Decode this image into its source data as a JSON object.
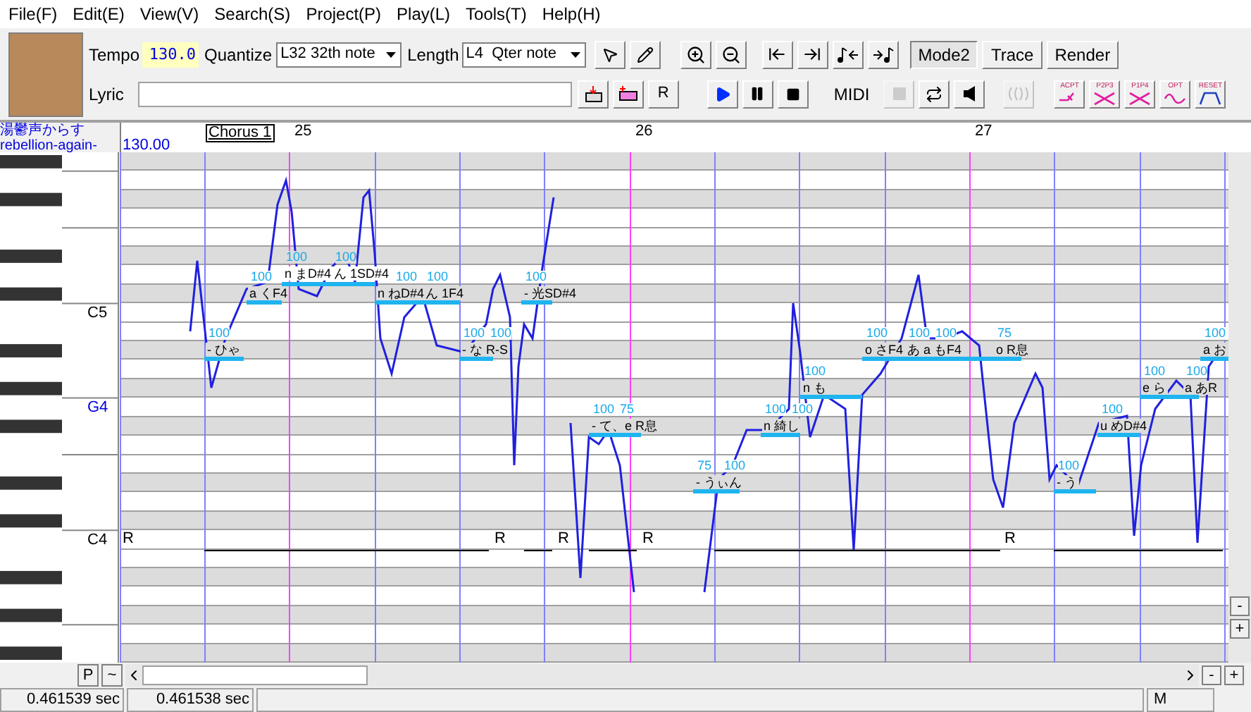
{
  "menu": [
    "File(F)",
    "Edit(E)",
    "View(V)",
    "Search(S)",
    "Project(P)",
    "Play(L)",
    "Tools(T)",
    "Help(H)"
  ],
  "toolbar": {
    "tempo_label": "Tempo",
    "tempo": "130.0",
    "quantize_label": "Quantize",
    "quantize": "L32 32th note",
    "length_label": "Length",
    "length": "L4  Qter note",
    "lyric_label": "Lyric",
    "insert_rest": "R",
    "midi_label": "MIDI"
  },
  "modes": [
    {
      "label": "Mode2",
      "selected": true
    },
    {
      "label": "Trace",
      "selected": false
    },
    {
      "label": "Render",
      "selected": false
    }
  ],
  "midi_buttons": [
    {
      "kind": "record",
      "disabled": true
    },
    {
      "kind": "sync",
      "disabled": false
    },
    {
      "kind": "speaker",
      "disabled": false
    },
    {
      "kind": "split",
      "disabled": true
    }
  ],
  "envelope_tools": [
    "ACPT",
    "P2P3",
    "P1P4",
    "OPT",
    "RESET"
  ],
  "track": {
    "singer": "湯鬱声からす",
    "name": "rebellion-again-"
  },
  "ruler": {
    "tempo": "130.00",
    "region": "Chorus 1",
    "bars": [
      "25",
      "26",
      "27"
    ]
  },
  "keys": [
    {
      "label": "C5",
      "selected": false
    },
    {
      "label": "G4",
      "selected": true
    },
    {
      "label": "C4",
      "selected": false
    }
  ],
  "notes": [
    {
      "kind": "rest",
      "lyric": "R"
    },
    {
      "kind": "note",
      "lyric": "- ひゃ",
      "velocities": [
        "100"
      ]
    },
    {
      "kind": "note",
      "lyric": "a くF4",
      "velocities": [
        "100"
      ]
    },
    {
      "kind": "note",
      "lyric": "n まD#4",
      "velocities": [
        "100"
      ]
    },
    {
      "kind": "note",
      "lyric": "ん 1SD#4",
      "velocities": [
        "100"
      ]
    },
    {
      "kind": "note",
      "lyric": "n ねD#4",
      "velocities": [
        "100"
      ]
    },
    {
      "kind": "note",
      "lyric": "ん 1F4",
      "velocities": [
        "100"
      ]
    },
    {
      "kind": "note",
      "lyric": "- な R-S",
      "velocities": [
        "100",
        "100"
      ]
    },
    {
      "kind": "rest",
      "lyric": "R"
    },
    {
      "kind": "note",
      "lyric": "- 光SD#4",
      "velocities": [
        "100"
      ]
    },
    {
      "kind": "rest",
      "lyric": "R"
    },
    {
      "kind": "note",
      "lyric": "- て、e R息",
      "velocities": [
        "100",
        "75"
      ]
    },
    {
      "kind": "rest",
      "lyric": "R"
    },
    {
      "kind": "note",
      "lyric": "- うぃん",
      "velocities": [
        "75",
        "100"
      ]
    },
    {
      "kind": "note",
      "lyric": "n 綺し",
      "velocities": [
        "100",
        "100"
      ]
    },
    {
      "kind": "note",
      "lyric": "n も",
      "velocities": [
        "100"
      ]
    },
    {
      "kind": "note",
      "lyric": "o さF4",
      "velocities": [
        "100"
      ]
    },
    {
      "kind": "note",
      "lyric": "あ a もF4",
      "velocities": [
        "100",
        "100"
      ]
    },
    {
      "kind": "note",
      "lyric": "o R息",
      "velocities": [
        "75"
      ]
    },
    {
      "kind": "rest",
      "lyric": "R"
    },
    {
      "kind": "note",
      "lyric": "- う",
      "velocities": [
        "100"
      ]
    },
    {
      "kind": "note",
      "lyric": "u めD#4",
      "velocities": [
        "100"
      ]
    },
    {
      "kind": "note",
      "lyric": "e ら",
      "velocities": [
        "100"
      ]
    },
    {
      "kind": "note",
      "lyric": "a あR",
      "velocities": [
        "100"
      ]
    },
    {
      "kind": "note",
      "lyric": "a お",
      "velocities": [
        "100"
      ]
    }
  ],
  "bottom": {
    "p_button": "P",
    "tilde_button": "~",
    "zoom_out": "-",
    "zoom_in": "+",
    "v_zoom_out": "-",
    "v_zoom_in": "+"
  },
  "status": [
    "0.461539 sec",
    "0.461538 sec",
    "M"
  ]
}
